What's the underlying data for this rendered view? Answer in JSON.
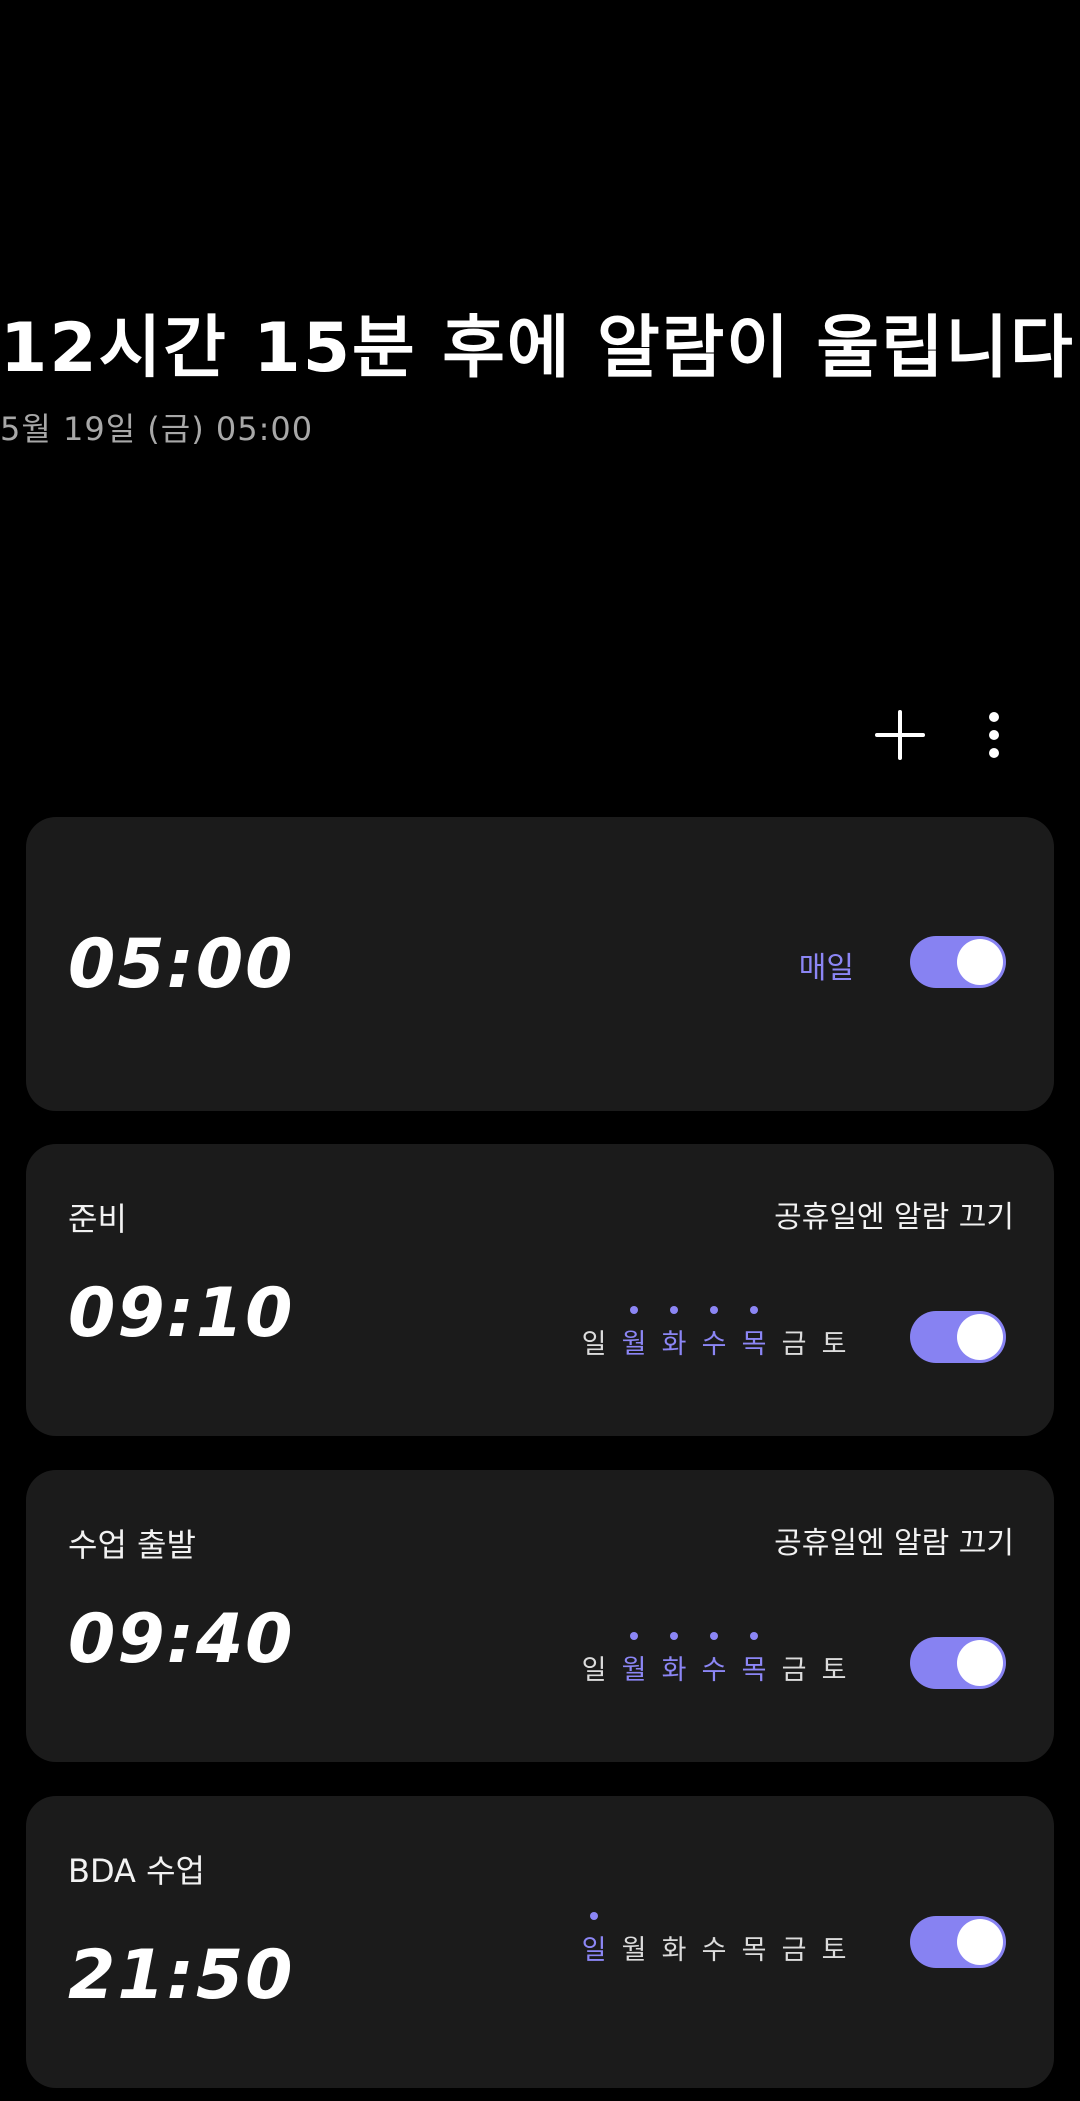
{
  "header": {
    "headline": "12시간 15분 후에 알람이 울립니다",
    "subline": "5월 19일 (금) 05:00"
  },
  "toolbar": {
    "add_icon": "plus-icon",
    "more_icon": "more-vertical-icon"
  },
  "colors": {
    "accent": "#8782f2",
    "card_bg": "#1b1b1b",
    "background": "#000000"
  },
  "alarms": [
    {
      "label": "",
      "holiday_text": "",
      "time": "05:00",
      "repeat_text": "매일",
      "enabled": true
    },
    {
      "label": "준비",
      "holiday_text": "공휴일엔 알람 끄기",
      "time": "09:10",
      "days": [
        {
          "d": "일",
          "active": false
        },
        {
          "d": "월",
          "active": true
        },
        {
          "d": "화",
          "active": true
        },
        {
          "d": "수",
          "active": true
        },
        {
          "d": "목",
          "active": true
        },
        {
          "d": "금",
          "active": false
        },
        {
          "d": "토",
          "active": false
        }
      ],
      "enabled": true
    },
    {
      "label": "수업 출발",
      "holiday_text": "공휴일엔 알람 끄기",
      "time": "09:40",
      "days": [
        {
          "d": "일",
          "active": false
        },
        {
          "d": "월",
          "active": true
        },
        {
          "d": "화",
          "active": true
        },
        {
          "d": "수",
          "active": true
        },
        {
          "d": "목",
          "active": true
        },
        {
          "d": "금",
          "active": false
        },
        {
          "d": "토",
          "active": false
        }
      ],
      "enabled": true
    },
    {
      "label": "BDA 수업",
      "holiday_text": "",
      "time": "21:50",
      "days": [
        {
          "d": "일",
          "active": true
        },
        {
          "d": "월",
          "active": false
        },
        {
          "d": "화",
          "active": false
        },
        {
          "d": "수",
          "active": false
        },
        {
          "d": "목",
          "active": false
        },
        {
          "d": "금",
          "active": false
        },
        {
          "d": "토",
          "active": false
        }
      ],
      "enabled": true
    }
  ]
}
